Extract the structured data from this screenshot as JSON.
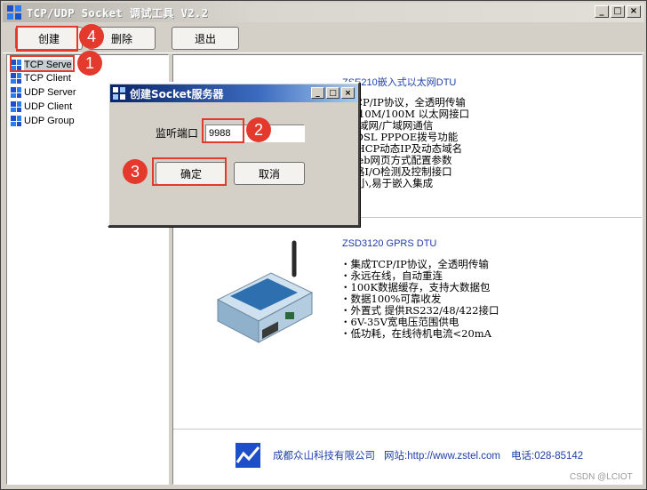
{
  "window": {
    "title": "TCP/UDP Socket 调试工具 V2.2",
    "min_glyph": "_",
    "max_glyph": "□",
    "close_glyph": "×"
  },
  "toolbar": {
    "create_label": "创建",
    "delete_label": "删除",
    "exit_label": "退出"
  },
  "tree": {
    "items": [
      {
        "label": "TCP Serve"
      },
      {
        "label": "TCP Client"
      },
      {
        "label": "UDP Server"
      },
      {
        "label": "UDP Client"
      },
      {
        "label": "UDP Group"
      }
    ]
  },
  "ad1": {
    "title": "ZSE210嵌入式以太网DTU",
    "features": [
      "成TCP/IP协议，全透明传输",
      "口转10M/100M 以太网接口",
      "持局域网/广域网通信",
      "成ADSL PPPOE拨号功能",
      "持DHCP动态IP及动态域名",
      "持Web网页方式配置参数",
      "供8路I/O检测及控制接口",
      "寸极小,易于嵌入集成"
    ]
  },
  "ad2": {
    "title": "ZSD3120 GPRS DTU",
    "features": [
      "・集成TCP/IP协议，全透明传输",
      "・永远在线，自动重连",
      "・100K数据缓存，支持大数据包",
      "・数据100%可靠收发",
      "・外置式 提供RS232/48/422接口",
      "・6V-35V宽电压范围供电",
      "・低功耗，在线待机电流<20mA"
    ]
  },
  "footer": {
    "company": "成都众山科技有限公司",
    "website_label": "网站:http://www.zstel.com",
    "phone_label": "电话:028-85142"
  },
  "watermark": "CSDN @LCIOT",
  "dialog": {
    "title": "创建Socket服务器",
    "port_label": "监听端口",
    "port_value": "9988",
    "ok_label": "确定",
    "cancel_label": "取消"
  },
  "markers": {
    "m1": "1",
    "m2": "2",
    "m3": "3",
    "m4": "4"
  },
  "colors": {
    "annotation": "#e43a2e",
    "dialog_title": "#0a246a",
    "link_blue": "#1f3fa8"
  }
}
